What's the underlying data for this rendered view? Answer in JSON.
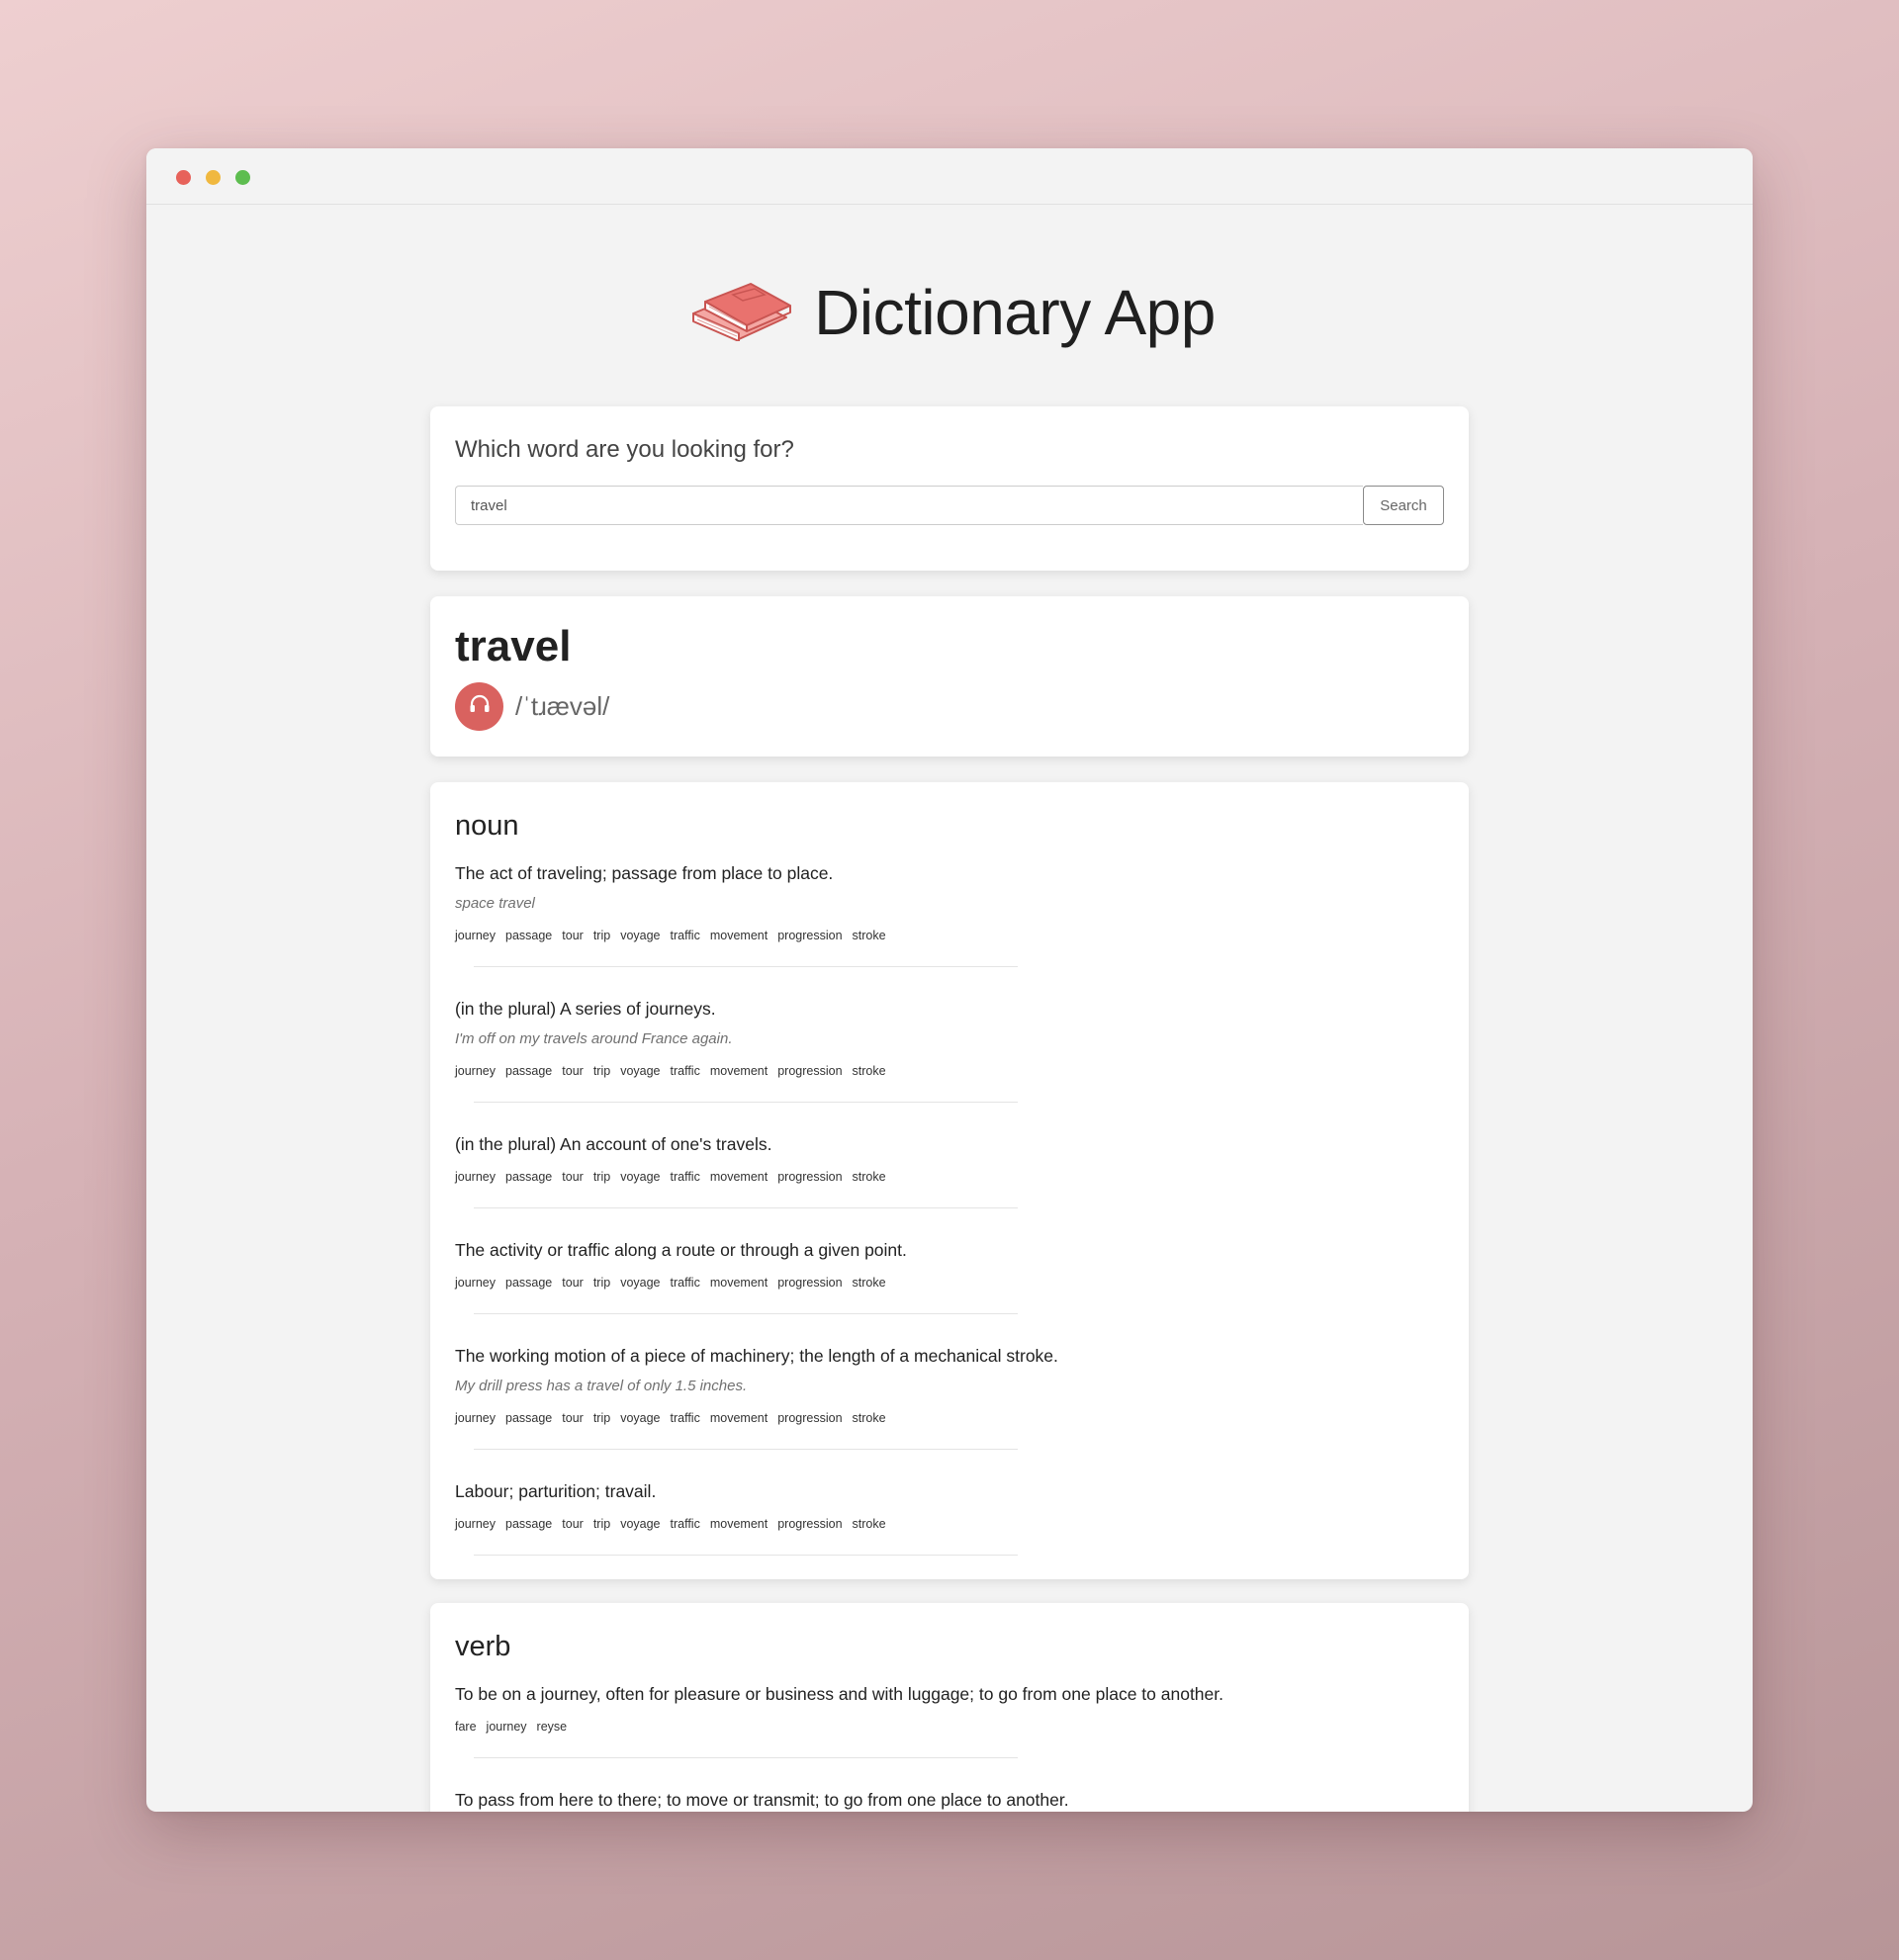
{
  "app": {
    "title": "Dictionary App",
    "accent_color": "#d9625f",
    "logo_icon": "books-icon"
  },
  "search": {
    "question": "Which word are you looking for?",
    "value": "travel",
    "button_label": "Search"
  },
  "word": {
    "title": "travel",
    "phonetic": "/ˈtɹævəl/",
    "audio_icon": "headphones-icon"
  },
  "meanings": [
    {
      "part_of_speech": "noun",
      "definitions": [
        {
          "text": "The act of traveling; passage from place to place.",
          "example": "space travel",
          "synonyms": [
            "journey",
            "passage",
            "tour",
            "trip",
            "voyage",
            "traffic",
            "movement",
            "progression",
            "stroke"
          ]
        },
        {
          "text": "(in the plural) A series of journeys.",
          "example": "I'm off on my travels around France again.",
          "synonyms": [
            "journey",
            "passage",
            "tour",
            "trip",
            "voyage",
            "traffic",
            "movement",
            "progression",
            "stroke"
          ]
        },
        {
          "text": "(in the plural) An account of one's travels.",
          "example": "",
          "synonyms": [
            "journey",
            "passage",
            "tour",
            "trip",
            "voyage",
            "traffic",
            "movement",
            "progression",
            "stroke"
          ]
        },
        {
          "text": "The activity or traffic along a route or through a given point.",
          "example": "",
          "synonyms": [
            "journey",
            "passage",
            "tour",
            "trip",
            "voyage",
            "traffic",
            "movement",
            "progression",
            "stroke"
          ]
        },
        {
          "text": "The working motion of a piece of machinery; the length of a mechanical stroke.",
          "example": "My drill press has a travel of only 1.5 inches.",
          "synonyms": [
            "journey",
            "passage",
            "tour",
            "trip",
            "voyage",
            "traffic",
            "movement",
            "progression",
            "stroke"
          ]
        },
        {
          "text": "Labour; parturition; travail.",
          "example": "",
          "synonyms": [
            "journey",
            "passage",
            "tour",
            "trip",
            "voyage",
            "traffic",
            "movement",
            "progression",
            "stroke"
          ]
        }
      ]
    },
    {
      "part_of_speech": "verb",
      "definitions": [
        {
          "text": "To be on a journey, often for pleasure or business and with luggage; to go from one place to another.",
          "example": "",
          "synonyms": [
            "fare",
            "journey",
            "reyse"
          ]
        },
        {
          "text": "To pass from here to there; to move or transmit; to go from one place to another.",
          "example": "",
          "synonyms": []
        }
      ]
    }
  ]
}
